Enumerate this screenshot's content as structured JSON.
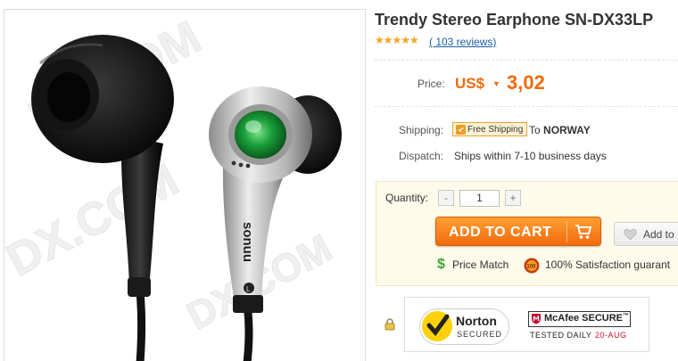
{
  "product": {
    "title": "Trendy Stereo Earphone SN-DX33LP",
    "rating_stars": 4.5,
    "stars_glyphs": "★★★★★",
    "reviews_label": "( 103 reviews)",
    "photo_brand_text": "sonuu",
    "watermark": "DX.COM"
  },
  "price": {
    "label": "Price:",
    "currency": "US$",
    "currency_caret": "▼",
    "value": "3,02"
  },
  "shipping": {
    "label": "Shipping:",
    "badge": "Free Shipping",
    "to_prefix": "To",
    "country": "NORWAY"
  },
  "dispatch": {
    "label": "Dispatch:",
    "value": "Ships within 7-10 business days"
  },
  "cart": {
    "quantity_label": "Quantity:",
    "minus": "-",
    "plus": "+",
    "quantity_value": "1",
    "add_to_cart": "ADD TO CART",
    "wishlist": "Add to"
  },
  "assurance": {
    "price_match_icon": "$",
    "price_match": "Price Match",
    "satisfaction": "100% Satisfaction guarant"
  },
  "security": {
    "norton_title": "Norton",
    "norton_sub": "SECURED",
    "mcafee_title": "McAfee SECURE",
    "mcafee_trademark": "™",
    "mcafee_tested": "TESTED DAILY",
    "mcafee_date": "20-AUG"
  },
  "colors": {
    "accent_orange": "#f26a0c",
    "link_blue": "#1a5fa8",
    "star_gold": "#f5a623",
    "price_match_green": "#3aa23a",
    "mcafee_red": "#c8102e"
  },
  "icons": [
    "plane-icon",
    "cart-icon",
    "heart-icon",
    "dollar-icon",
    "seal-icon",
    "lock-icon",
    "norton-check-icon",
    "mcafee-shield-icon"
  ]
}
